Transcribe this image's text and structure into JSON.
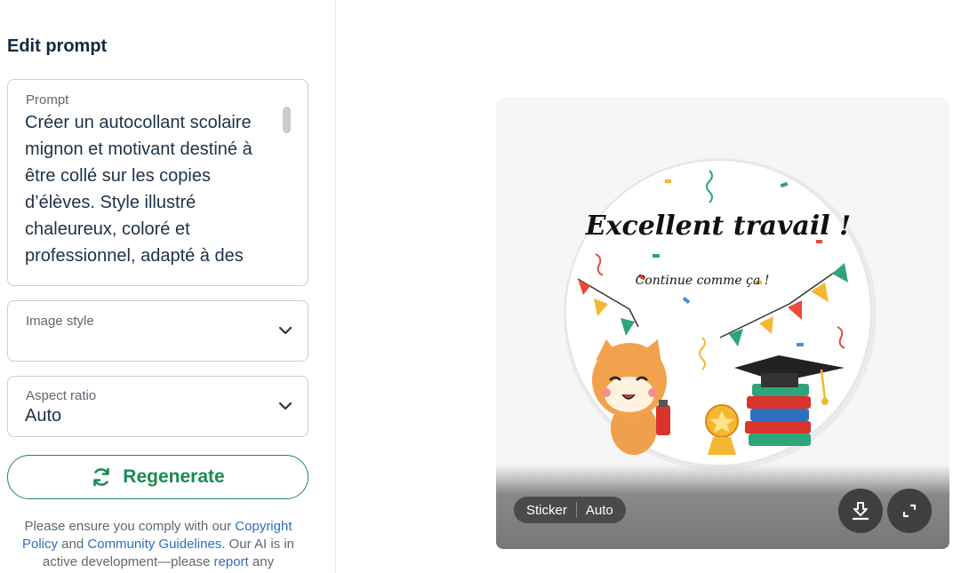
{
  "panel": {
    "title": "Edit prompt"
  },
  "prompt": {
    "label": "Prompt",
    "value": "Créer un autocollant scolaire mignon et motivant destiné à être collé sur les copies d’élèves. Style illustré chaleureux, coloré et professionnel, adapté à des"
  },
  "image_style": {
    "label": "Image style",
    "value": ""
  },
  "aspect_ratio": {
    "label": "Aspect ratio",
    "value": "Auto"
  },
  "regenerate": {
    "label": "Regenerate",
    "icon": "refresh-icon",
    "color": "#1a8a55"
  },
  "disclaimer": {
    "part1": "Please ensure you comply with our ",
    "link_copyright": "Copyright Policy",
    "part2": " and ",
    "link_guidelines": "Community Guidelines",
    "part3": ". Our AI is in active development—please ",
    "link_report": "report",
    "part4": " any"
  },
  "preview": {
    "sticker_title": "Excellent travail !",
    "sticker_subtitle": "Continue comme ça !",
    "tag_type": "Sticker",
    "tag_ratio": "Auto",
    "download_icon": "download-icon",
    "expand_icon": "expand-icon"
  },
  "colors": {
    "accent": "#1a8a55",
    "link": "#2f6fc0"
  }
}
